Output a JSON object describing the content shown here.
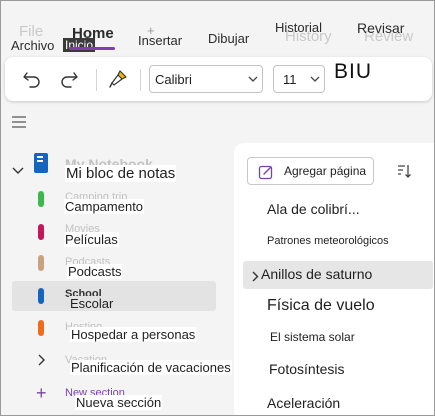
{
  "ribbon": {
    "tabs_ghost": {
      "file": "File",
      "home": "Home",
      "history": "History",
      "review": "Review"
    },
    "tabs": {
      "file": "Archivo",
      "home": "Inicio",
      "insert": "Insertar",
      "draw": "Dibujar",
      "history": "Historial",
      "review": "Revisar"
    }
  },
  "toolbar": {
    "font_family": "Calibri",
    "font_size": "11",
    "format_label": "BIU"
  },
  "notebook": {
    "title": "Mi bloc de notas",
    "title_ghost": "My Notebook",
    "sections": [
      {
        "label": "Campamento",
        "ghost": "Camping trip",
        "color": "#3db84a"
      },
      {
        "label": "Películas",
        "ghost": "Movies",
        "color": "#c2185b"
      },
      {
        "label": "Podcasts",
        "ghost": "Podcasts",
        "color": "#c9a27e"
      },
      {
        "label": "Escolar",
        "ghost": "School",
        "color": "#1565c0"
      },
      {
        "label": "Hospedar a personas",
        "ghost": "Hosting",
        "color": "#ef6c1a"
      },
      {
        "label": "Planificación de vacaciones",
        "ghost": "Vacation",
        "color": ""
      }
    ],
    "new_section": "Nueva sección",
    "new_section_ghost": "New section"
  },
  "pages": {
    "add_label": "Agregar página",
    "items": [
      {
        "label": "Ala de colibrí..."
      },
      {
        "label": "Patrones meteorológicos"
      },
      {
        "label": "Anillos de saturno"
      },
      {
        "label": "Física de vuelo"
      },
      {
        "label": "El sistema solar"
      },
      {
        "label": "Fotosíntesis"
      },
      {
        "label": "Aceleración"
      }
    ]
  },
  "colors": {
    "accent": "#7b3fb0",
    "notebook_icon": "#1565c0"
  }
}
